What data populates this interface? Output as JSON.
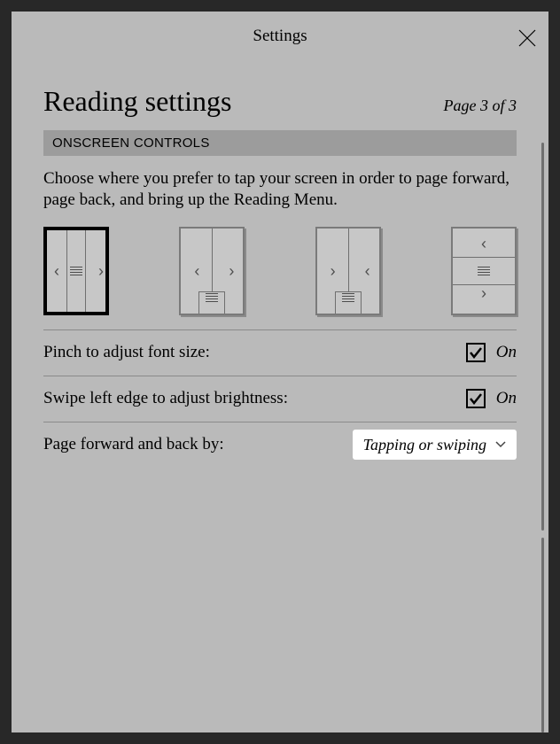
{
  "header": {
    "title": "Settings"
  },
  "page": {
    "title": "Reading settings",
    "indicator": "Page 3 of 3"
  },
  "section": {
    "label": "ONSCREEN CONTROLS",
    "description": "Choose where you prefer to tap your screen in order to page forward, page back, and bring up the Reading Menu."
  },
  "rows": {
    "pinch": {
      "label": "Pinch to adjust font size:",
      "state": "On"
    },
    "swipe": {
      "label": "Swipe left edge to adjust brightness:",
      "state": "On"
    },
    "pagefwd": {
      "label": "Page forward and back by:",
      "value": "Tapping or swiping"
    }
  }
}
